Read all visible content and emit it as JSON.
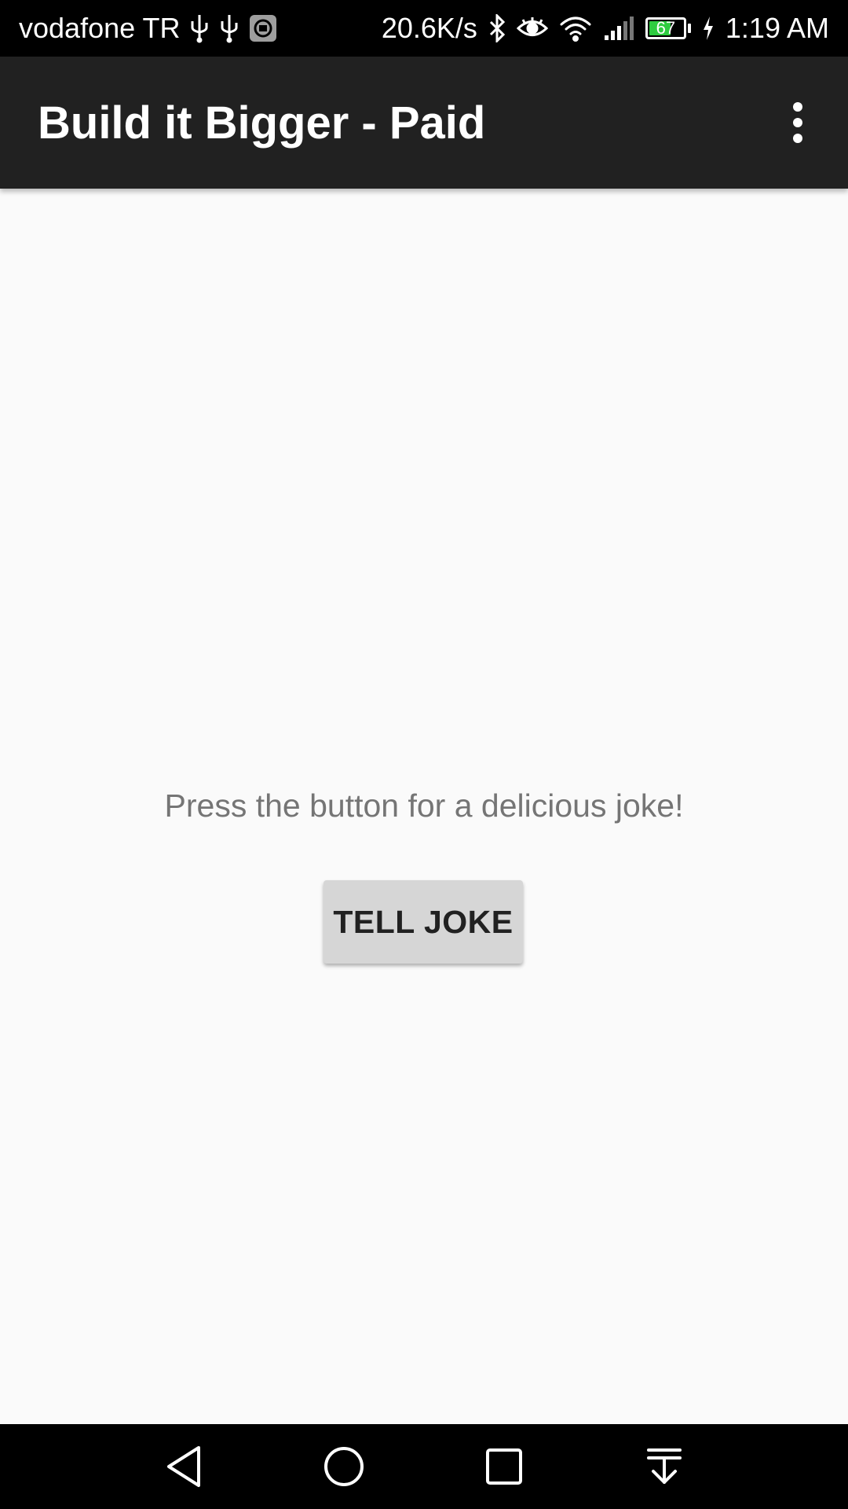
{
  "status_bar": {
    "carrier": "vodafone TR",
    "net_speed": "20.6K/s",
    "battery_level": "67",
    "battery_fraction": 0.67,
    "time": "1:19 AM",
    "icons": [
      "usb-icon",
      "usb-icon",
      "mi-icon",
      "bluetooth-icon",
      "eye-icon",
      "wifi-icon",
      "signal-icon",
      "battery-icon",
      "charging-icon"
    ],
    "battery_color": "#2ecc40"
  },
  "app_bar": {
    "title": "Build it Bigger - Paid",
    "background": "#212121",
    "overflow_icon": "more-vert-icon"
  },
  "main": {
    "instructions": "Press the button for a delicious joke!",
    "tell_joke_label": "TELL JOKE",
    "background": "#fafafa"
  },
  "nav_bar": {
    "buttons": [
      "back-icon",
      "home-icon",
      "recents-icon",
      "notification-pull-icon"
    ]
  }
}
